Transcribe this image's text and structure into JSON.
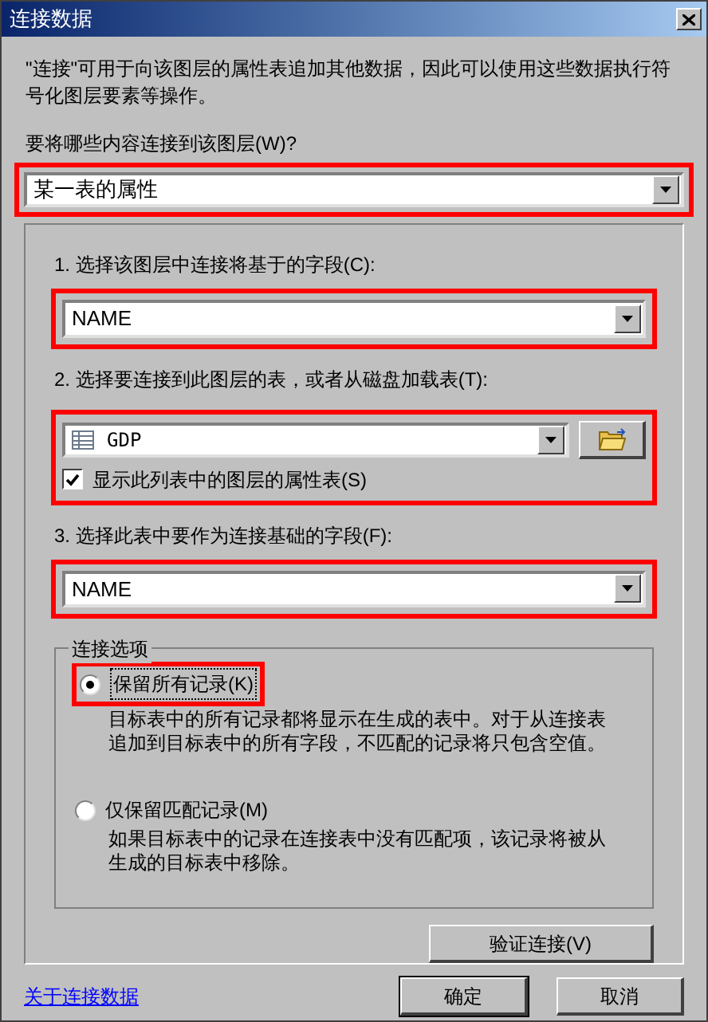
{
  "window": {
    "title": "连接数据"
  },
  "intro": "\"连接\"可用于向该图层的属性表追加其他数据，因此可以使用这些数据执行符号化图层要素等操作。",
  "what": {
    "label": "要将哪些内容连接到该图层(W)?",
    "value": "某一表的属性",
    "highlighted": true
  },
  "steps": [
    {
      "kind": "field",
      "label": "1. 选择该图层中连接将基于的字段(C):",
      "value": "NAME",
      "highlighted": true
    },
    {
      "kind": "table",
      "label": "2. 选择要连接到此图层的表，或者从磁盘加载表(T):",
      "value": "GDP",
      "highlighted": true,
      "checkbox": {
        "label": "显示此列表中的图层的属性表(S)",
        "checked": true
      }
    },
    {
      "kind": "field",
      "label": "3. 选择此表中要作为连接基础的字段(F):",
      "value": "NAME",
      "highlighted": true
    }
  ],
  "join_options": {
    "title": "连接选项",
    "options": [
      {
        "label": "保留所有记录(K)",
        "description": "目标表中的所有记录都将显示在生成的表中。对于从连接表追加到目标表中的所有字段，不匹配的记录将只包含空值。",
        "selected": true,
        "highlighted": true
      },
      {
        "label": "仅保留匹配记录(M)",
        "description": "如果目标表中的记录在连接表中没有匹配项，该记录将被从生成的目标表中移除。",
        "selected": false,
        "highlighted": false
      }
    ]
  },
  "validate_button": "验证连接(V)",
  "help_link": "关于连接数据",
  "buttons": [
    "确定",
    "取消"
  ]
}
